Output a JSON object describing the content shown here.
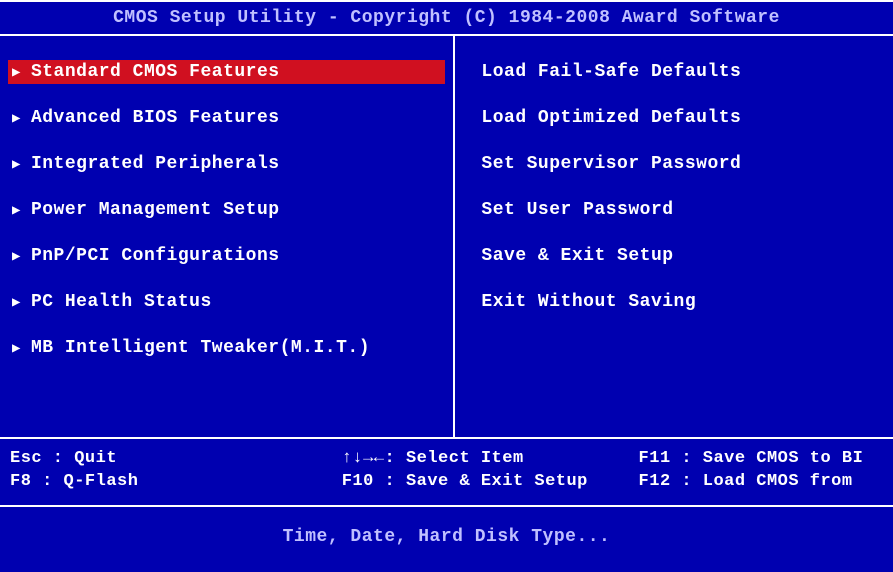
{
  "header": {
    "title": "CMOS Setup Utility - Copyright (C) 1984-2008 Award Software"
  },
  "left_menu": {
    "items": [
      {
        "label": "Standard CMOS Features",
        "selected": true
      },
      {
        "label": "Advanced BIOS Features",
        "selected": false
      },
      {
        "label": "Integrated Peripherals",
        "selected": false
      },
      {
        "label": "Power Management Setup",
        "selected": false
      },
      {
        "label": "PnP/PCI Configurations",
        "selected": false
      },
      {
        "label": "PC Health Status",
        "selected": false
      },
      {
        "label": "MB Intelligent Tweaker(M.I.T.)",
        "selected": false
      }
    ]
  },
  "right_menu": {
    "items": [
      {
        "label": "Load Fail-Safe Defaults"
      },
      {
        "label": "Load Optimized Defaults"
      },
      {
        "label": "Set Supervisor Password"
      },
      {
        "label": "Set User Password"
      },
      {
        "label": "Save & Exit Setup"
      },
      {
        "label": "Exit Without Saving"
      }
    ]
  },
  "footer": {
    "esc": "Esc : Quit",
    "f8": "F8  : Q-Flash",
    "arrows": "↑↓→←: Select Item",
    "f10": "F10 : Save & Exit Setup",
    "f11": "F11 : Save CMOS to BI",
    "f12": "F12 : Load CMOS from"
  },
  "status": {
    "hint": "Time, Date, Hard Disk Type..."
  }
}
